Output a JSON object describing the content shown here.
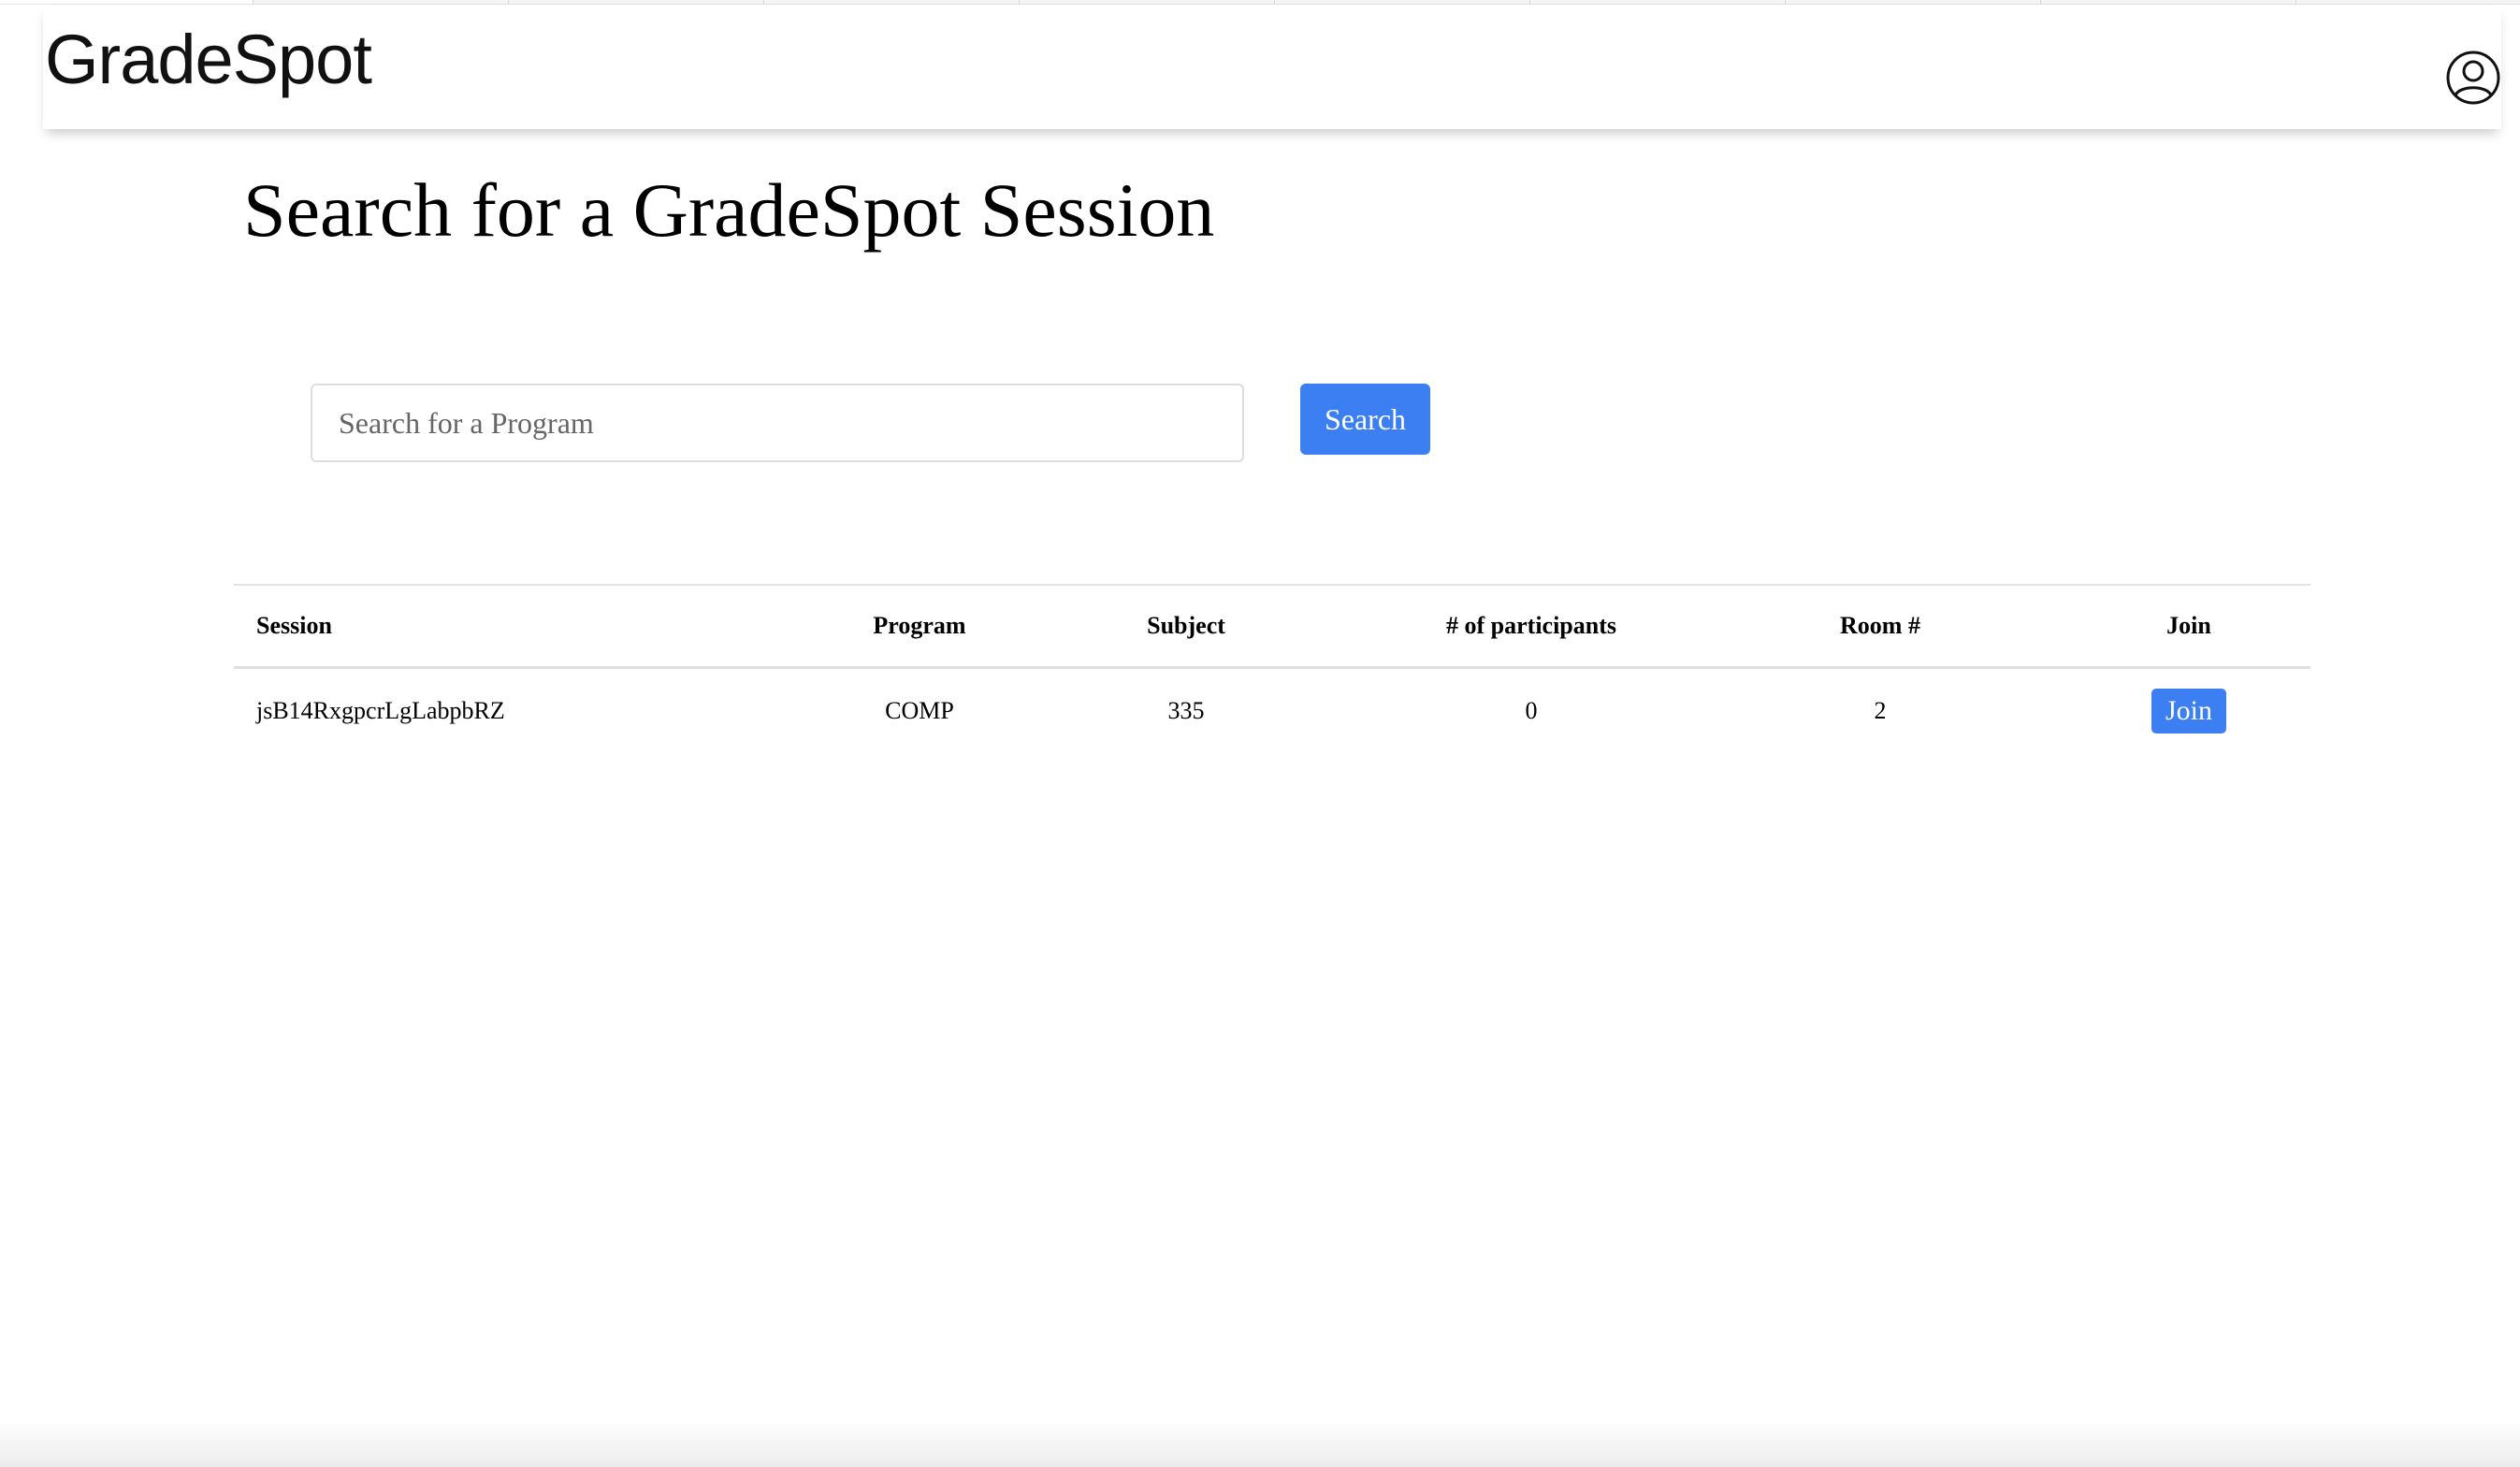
{
  "app": {
    "brand": "GradeSpot"
  },
  "page": {
    "title": "Search for a GradeSpot Session"
  },
  "search": {
    "value": "",
    "placeholder": "Search for a Program",
    "button_label": "Search"
  },
  "table": {
    "columns": [
      "Session",
      "Program",
      "Subject",
      "# of participants",
      "Room #",
      "Join"
    ],
    "rows": [
      {
        "session": "jsB14RxgpcrLgLabpbRZ",
        "program": "COMP",
        "subject": "335",
        "participants": "0",
        "room": "2",
        "join_label": "Join"
      }
    ]
  },
  "icons": {
    "account": "user-circle-icon"
  },
  "colors": {
    "accent": "#3b7ff2",
    "text": "#000000",
    "background": "#ffffff"
  }
}
